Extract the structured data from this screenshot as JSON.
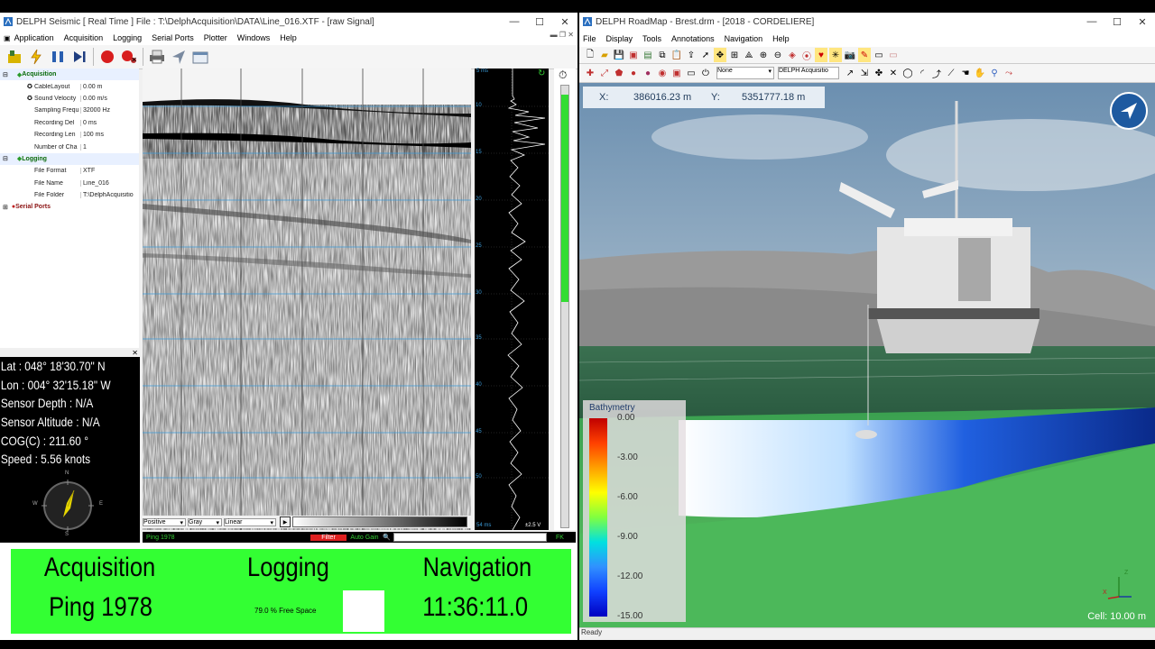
{
  "seismic": {
    "title": "DELPH Seismic [ Real Time ] File : T:\\DelphAcquisition\\DATA\\Line_016.XTF - [raw Signal]",
    "menu": [
      "Application",
      "Acquisition",
      "Logging",
      "Serial Ports",
      "Plotter",
      "Windows",
      "Help"
    ],
    "tree": {
      "acquisition_label": "Acquisition",
      "acq_rows": [
        {
          "label": "CableLayout",
          "value": "0.00 m"
        },
        {
          "label": "Sound Velocity",
          "value": "0.00 m/s"
        },
        {
          "label": "Sampling Frequ",
          "value": "32000 Hz"
        },
        {
          "label": "Recording Del",
          "value": "0 ms"
        },
        {
          "label": "Recording Len",
          "value": "100 ms"
        },
        {
          "label": "Number of Cha",
          "value": "1"
        }
      ],
      "logging_label": "Logging",
      "log_rows": [
        {
          "label": "File Format",
          "value": "XTF"
        },
        {
          "label": "File Name",
          "value": "Line_016"
        },
        {
          "label": "File Folder",
          "value": "T:\\DelphAcquisitio"
        }
      ],
      "serial_label": "Serial Ports"
    },
    "nav": {
      "lat": "Lat      : 048° 18'30.70\" N",
      "lon": "Lon      : 004° 32'15.18\" W",
      "depth": "Sensor Depth  : N/A",
      "altitude": "Sensor Altitude : N/A",
      "cog": "COG(C) : 211.60 °",
      "speed": "Speed   : 5.56 knots",
      "compass": {
        "n": "N",
        "e": "E",
        "s": "S",
        "w": "W"
      }
    },
    "x_ticks": [
      "1500",
      "1600",
      "1700",
      "1800",
      "1900"
    ],
    "controls": {
      "polarity": "Positive",
      "palette": "Gray",
      "scale": "Linear"
    },
    "trace_labels": {
      "top": "5 ms",
      "bottom": "54 ms",
      "gain": "±2.5 V",
      "y_ticks": [
        "10",
        "15",
        "20",
        "25",
        "30",
        "35",
        "40",
        "45",
        "50"
      ]
    },
    "status": {
      "ping": "Ping 1978",
      "filter": "Filter",
      "autogain": "Auto Gain",
      "fk": "FK"
    },
    "big": {
      "acq": "Acquisition",
      "ping": "Ping 1978",
      "logging": "Logging",
      "free": "79.0 % Free Space",
      "navigation": "Navigation",
      "time": "11:36:11.0"
    }
  },
  "roadmap": {
    "title": "DELPH RoadMap - Brest.drm - [2018 - CORDELIERE]",
    "menu": [
      "File",
      "Display",
      "Tools",
      "Annotations",
      "Navigation",
      "Help"
    ],
    "combo1": "None",
    "combo2": "DELPH Acquisitio",
    "x_label": "X:",
    "x_value": "386016.23 m",
    "y_label": "Y:",
    "y_value": "5351777.18 m",
    "legend_title": "Bathymetry",
    "legend_ticks": [
      "0.00",
      "-3.00",
      "-6.00",
      "-9.00",
      "-12.00",
      "-15.00"
    ],
    "cell": "Cell: 10.00 m",
    "axes": {
      "z": "Z",
      "x": "X"
    },
    "status": "Ready"
  }
}
